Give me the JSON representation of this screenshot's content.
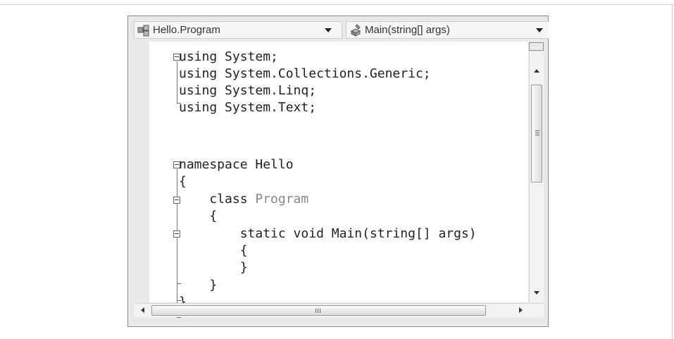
{
  "navbar": {
    "type_dropdown": {
      "value": "Hello.Program",
      "icon": "class-icon"
    },
    "member_dropdown": {
      "value": "Main(string[] args)",
      "icon": "method-icon"
    }
  },
  "code": {
    "lines": [
      "using System;",
      "using System.Collections.Generic;",
      "using System.Linq;",
      "using System.Text;",
      "",
      "namespace Hello",
      "{",
      "    class ",
      "    {",
      "        static void Main(string[] args)",
      "        {",
      "        }",
      "    }",
      "}"
    ],
    "class_name": "Program",
    "colors": {
      "text": "#222222",
      "type_name": "#888888"
    }
  },
  "scrollbars": {
    "horizontal_grip": "III",
    "vertical_grip": "≡"
  }
}
